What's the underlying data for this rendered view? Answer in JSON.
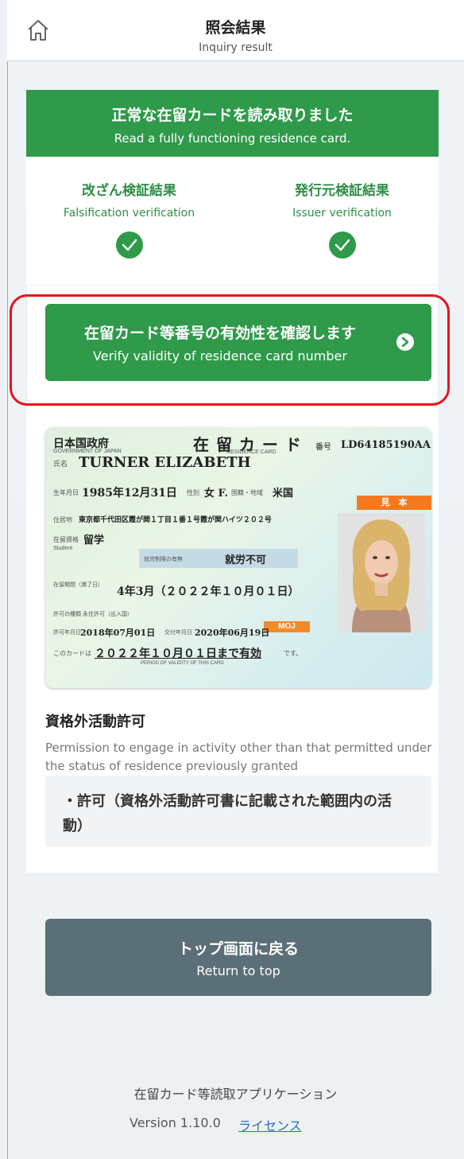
{
  "header": {
    "title": "照会結果",
    "subtitle": "Inquiry result",
    "home_icon": "home-icon"
  },
  "status": {
    "title_jp": "正常な在留カードを読み取りました",
    "title_en": "Read a fully functioning residence card.",
    "accent_color": "#2e9a4a",
    "checks": [
      {
        "label_jp": "改ざん検証結果",
        "label_en": "Falsification verification",
        "icon": "check-circle-icon"
      },
      {
        "label_jp": "発行元検証結果",
        "label_en": "Issuer verification",
        "icon": "check-circle-icon"
      }
    ]
  },
  "verify_button": {
    "label_jp": "在留カード等番号の有効性を確認します",
    "label_en": "Verify validity of residence card number",
    "icon": "chevron-right-icon",
    "highlight_color": "#e8131a"
  },
  "residence_card": {
    "gov_jp": "日本国政府",
    "gov_en": "GOVERNMENT OF JAPAN",
    "card_jp": "在 留 カ ー ド",
    "card_en": "RESIDENCE CARD",
    "number_label": "番号",
    "number": "LD64185190AA",
    "name_label": "氏名",
    "name": "TURNER  ELIZABETH",
    "dob_label": "生年月日",
    "dob": "1985年12月31日",
    "sex_label": "性別",
    "sex": "女 F.",
    "nationality_label": "国籍・地域",
    "nationality": "米国",
    "address_label": "住居地",
    "address": "東京都千代田区霞が関１丁目１番１号霞が関ハイツ２０２号",
    "status_label": "在留資格",
    "status": "留学",
    "status_en": "Student",
    "work_label": "就労制限の有無",
    "work": "就労不可",
    "period_label": "在留期間（満了日）",
    "period": "4年3月（２０２２年１０月０１日）",
    "permit_type": "許可の種類  永住許可（出入国）",
    "permit_date_label": "許可年月日",
    "permit_date": "2018年07月01日",
    "issue_label": "交付年月日",
    "issue_date": "2020年06月19日",
    "valid_prefix": "このカードは",
    "valid_until": "２０２２年１０月０１日まで有効",
    "valid_suffix": "です。",
    "valid_en": "PERIOD OF VALIDITY OF THIS CARD",
    "sample_label": "見　本",
    "moj": "MOJ"
  },
  "permission": {
    "title": "資格外活動許可",
    "description": "Permission to engage in activity other than that permitted under the status of residence previously granted",
    "value": "・許可（資格外活動許可書に記載された範囲内の活動）"
  },
  "back_button": {
    "label_jp": "トップ画面に戻る",
    "label_en": "Return to top",
    "color": "#5a6f78"
  },
  "footer": {
    "app_name": "在留カード等読取アプリケーション",
    "version": "Version 1.10.0",
    "license_link": "ライセンス"
  }
}
